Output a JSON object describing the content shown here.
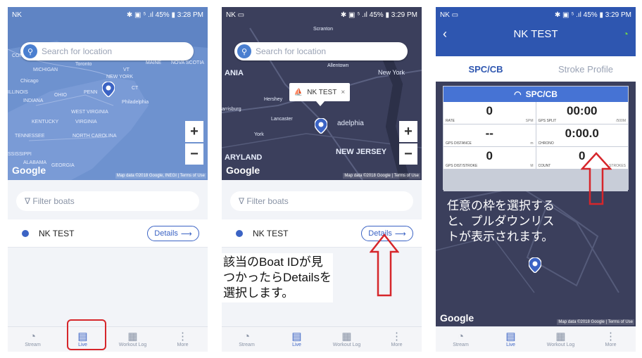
{
  "status": [
    {
      "left": "NK",
      "right": "✱ ▣ ⁵ .ıl 45% ▮ 3:28 PM"
    },
    {
      "left": "NK ▭",
      "right": "✱ ▣ ⁵ .ıl 45% ▮ 3:29 PM"
    },
    {
      "left": "NK ▭",
      "right": "✱ ▣ ⁵ .ıl 45% ▮ 3:29 PM"
    }
  ],
  "search_placeholder": "Search for location",
  "map1_labels": [
    "CONSIN",
    "MICHIGAN",
    "Toronto",
    "MAINE",
    "NOVA SCOTIA",
    "NEW YORK",
    "Chicago",
    "OHIO",
    "PENN",
    "INDIANA",
    "ILLINOIS",
    "WEST VIRGINIA",
    "KENTUCKY",
    "VIRGINIA",
    "TENNESSEE",
    "NORTH CAROLINA",
    "SSISSIPPI",
    "ALABAMA",
    "GEORGIA",
    "Philadelphia",
    "VT",
    "CT"
  ],
  "map2_labels": [
    "Scranton",
    "ANIA",
    "New York",
    "Hershey",
    "Allentown",
    "arrisburg",
    "Lancaster",
    "York",
    "adelphia",
    "NEW JERSEY",
    "ARYLAND"
  ],
  "google": "Google",
  "attrib1": "Map data ©2018 Google, INEGI | Terms of Use",
  "attrib2": "Map data ©2018 Google | Terms of Use",
  "attrib3": "Map data ©2018 Google | Terms of Use",
  "zoom_in": "+",
  "zoom_out": "−",
  "filter_placeholder": "∇ Filter boats",
  "boat_name": "NK TEST",
  "details_label": "Details",
  "popup_label": "NK TEST",
  "nav": [
    "Stream",
    "Live",
    "Workout Log",
    "More"
  ],
  "caption2": [
    "該当のBoat IDが見",
    "つかったらDetailsを",
    "選択します。"
  ],
  "screen3": {
    "title": "NK TEST",
    "tabs": [
      "SPC/CB",
      "Stroke Profile"
    ],
    "panel_title": "SPC/CB",
    "cells": [
      {
        "value": "0",
        "label": "RATE",
        "unit": "SPM"
      },
      {
        "value": "00:00",
        "label": "GPS SPLIT",
        "unit": "/500M"
      },
      {
        "value": "--",
        "label": "GPS DISTANCE",
        "unit": "m"
      },
      {
        "value": "0:00.0",
        "label": "CHRONO",
        "unit": ""
      },
      {
        "value": "0",
        "label": "GPS DIST/STROKE",
        "unit": "M"
      },
      {
        "value": "0",
        "label": "COUNT",
        "unit": "STROKES"
      }
    ],
    "caption": [
      "任意の枠を選択する",
      "と、プルダウンリス",
      "トが表示されます。"
    ]
  },
  "colors": {
    "accent": "#3b63c4",
    "highlight": "#d6262b",
    "active_live": "#6fd24a"
  }
}
